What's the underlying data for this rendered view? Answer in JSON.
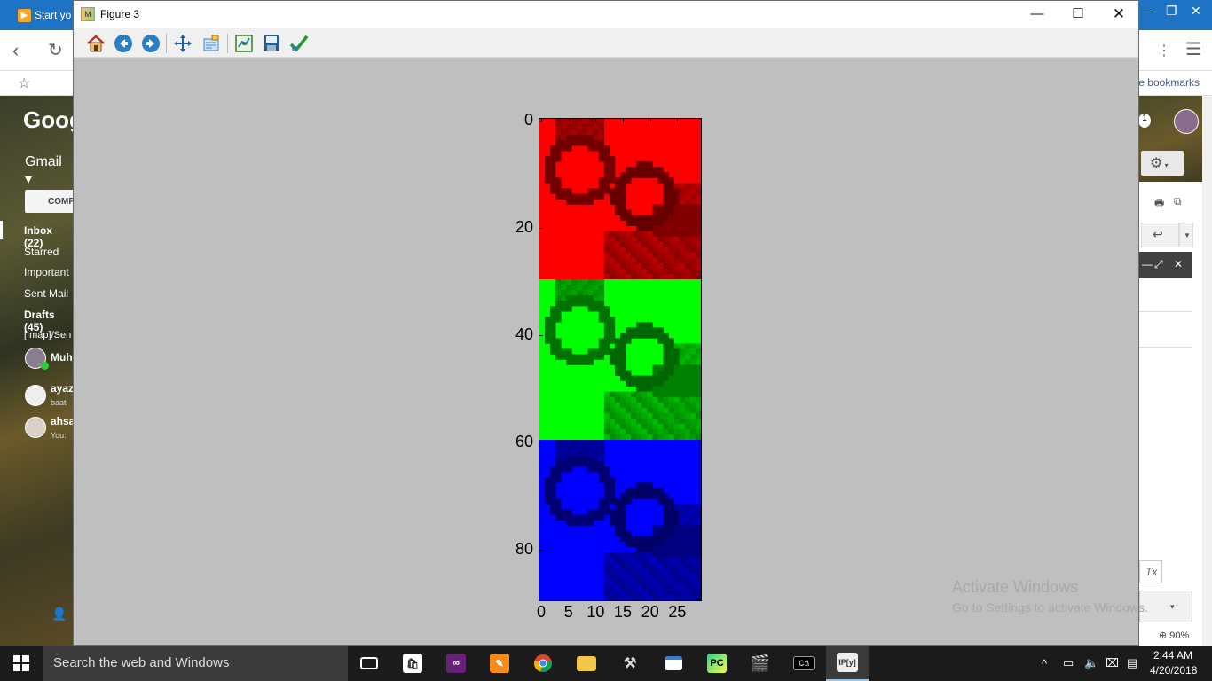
{
  "browser": {
    "tab_title": "Start yo",
    "bookmarks_text": "e bookmarks",
    "zoom": "90%"
  },
  "gmail": {
    "logo": "Goog",
    "menu": "Gmail ▾",
    "compose": "COMP",
    "nav": [
      {
        "label": "Inbox (22)",
        "bold": true
      },
      {
        "label": "Starred",
        "bold": false
      },
      {
        "label": "Important",
        "bold": false
      },
      {
        "label": "Sent Mail",
        "bold": false
      },
      {
        "label": "Drafts (45)",
        "bold": true
      },
      {
        "label": "[Imap]/Sen",
        "bold": false
      }
    ],
    "chats": [
      {
        "name": "Muh",
        "sub": ""
      },
      {
        "name": "ayaz",
        "sub": "baat"
      },
      {
        "name": "ahsa",
        "sub": "You:"
      }
    ]
  },
  "figure": {
    "window_title": "Figure 3",
    "toolbar": [
      {
        "name": "home-icon",
        "tooltip": "Home"
      },
      {
        "name": "back-icon",
        "tooltip": "Back"
      },
      {
        "name": "forward-icon",
        "tooltip": "Forward"
      },
      {
        "name": "pan-icon",
        "tooltip": "Pan"
      },
      {
        "name": "zoom-icon",
        "tooltip": "Zoom"
      },
      {
        "name": "subplots-icon",
        "tooltip": "Subplots"
      },
      {
        "name": "save-icon",
        "tooltip": "Save"
      },
      {
        "name": "edit-parameters-icon",
        "tooltip": "Edit"
      }
    ]
  },
  "chart_data": {
    "type": "heatmap",
    "title": "",
    "xlabel": "",
    "ylabel": "",
    "xlim": [
      -0.5,
      29.5
    ],
    "ylim": [
      89.5,
      -0.5
    ],
    "xticks": [
      0,
      5,
      10,
      15,
      20,
      25
    ],
    "yticks": [
      0,
      20,
      40,
      60,
      80
    ],
    "grid": false,
    "image_rows": 90,
    "image_cols": 30,
    "bands": [
      {
        "channel": "red",
        "rows": [
          0,
          29
        ],
        "color": "#ff0000"
      },
      {
        "channel": "green",
        "rows": [
          30,
          59
        ],
        "color": "#00ff00"
      },
      {
        "channel": "blue",
        "rows": [
          60,
          89
        ],
        "color": "#0000ff"
      }
    ]
  },
  "watermark": {
    "line1": "Activate Windows",
    "line2": "Go to Settings to activate Windows."
  },
  "taskbar": {
    "search_placeholder": "Search the web and Windows",
    "time": "2:44 AM",
    "date": "4/20/2018"
  }
}
